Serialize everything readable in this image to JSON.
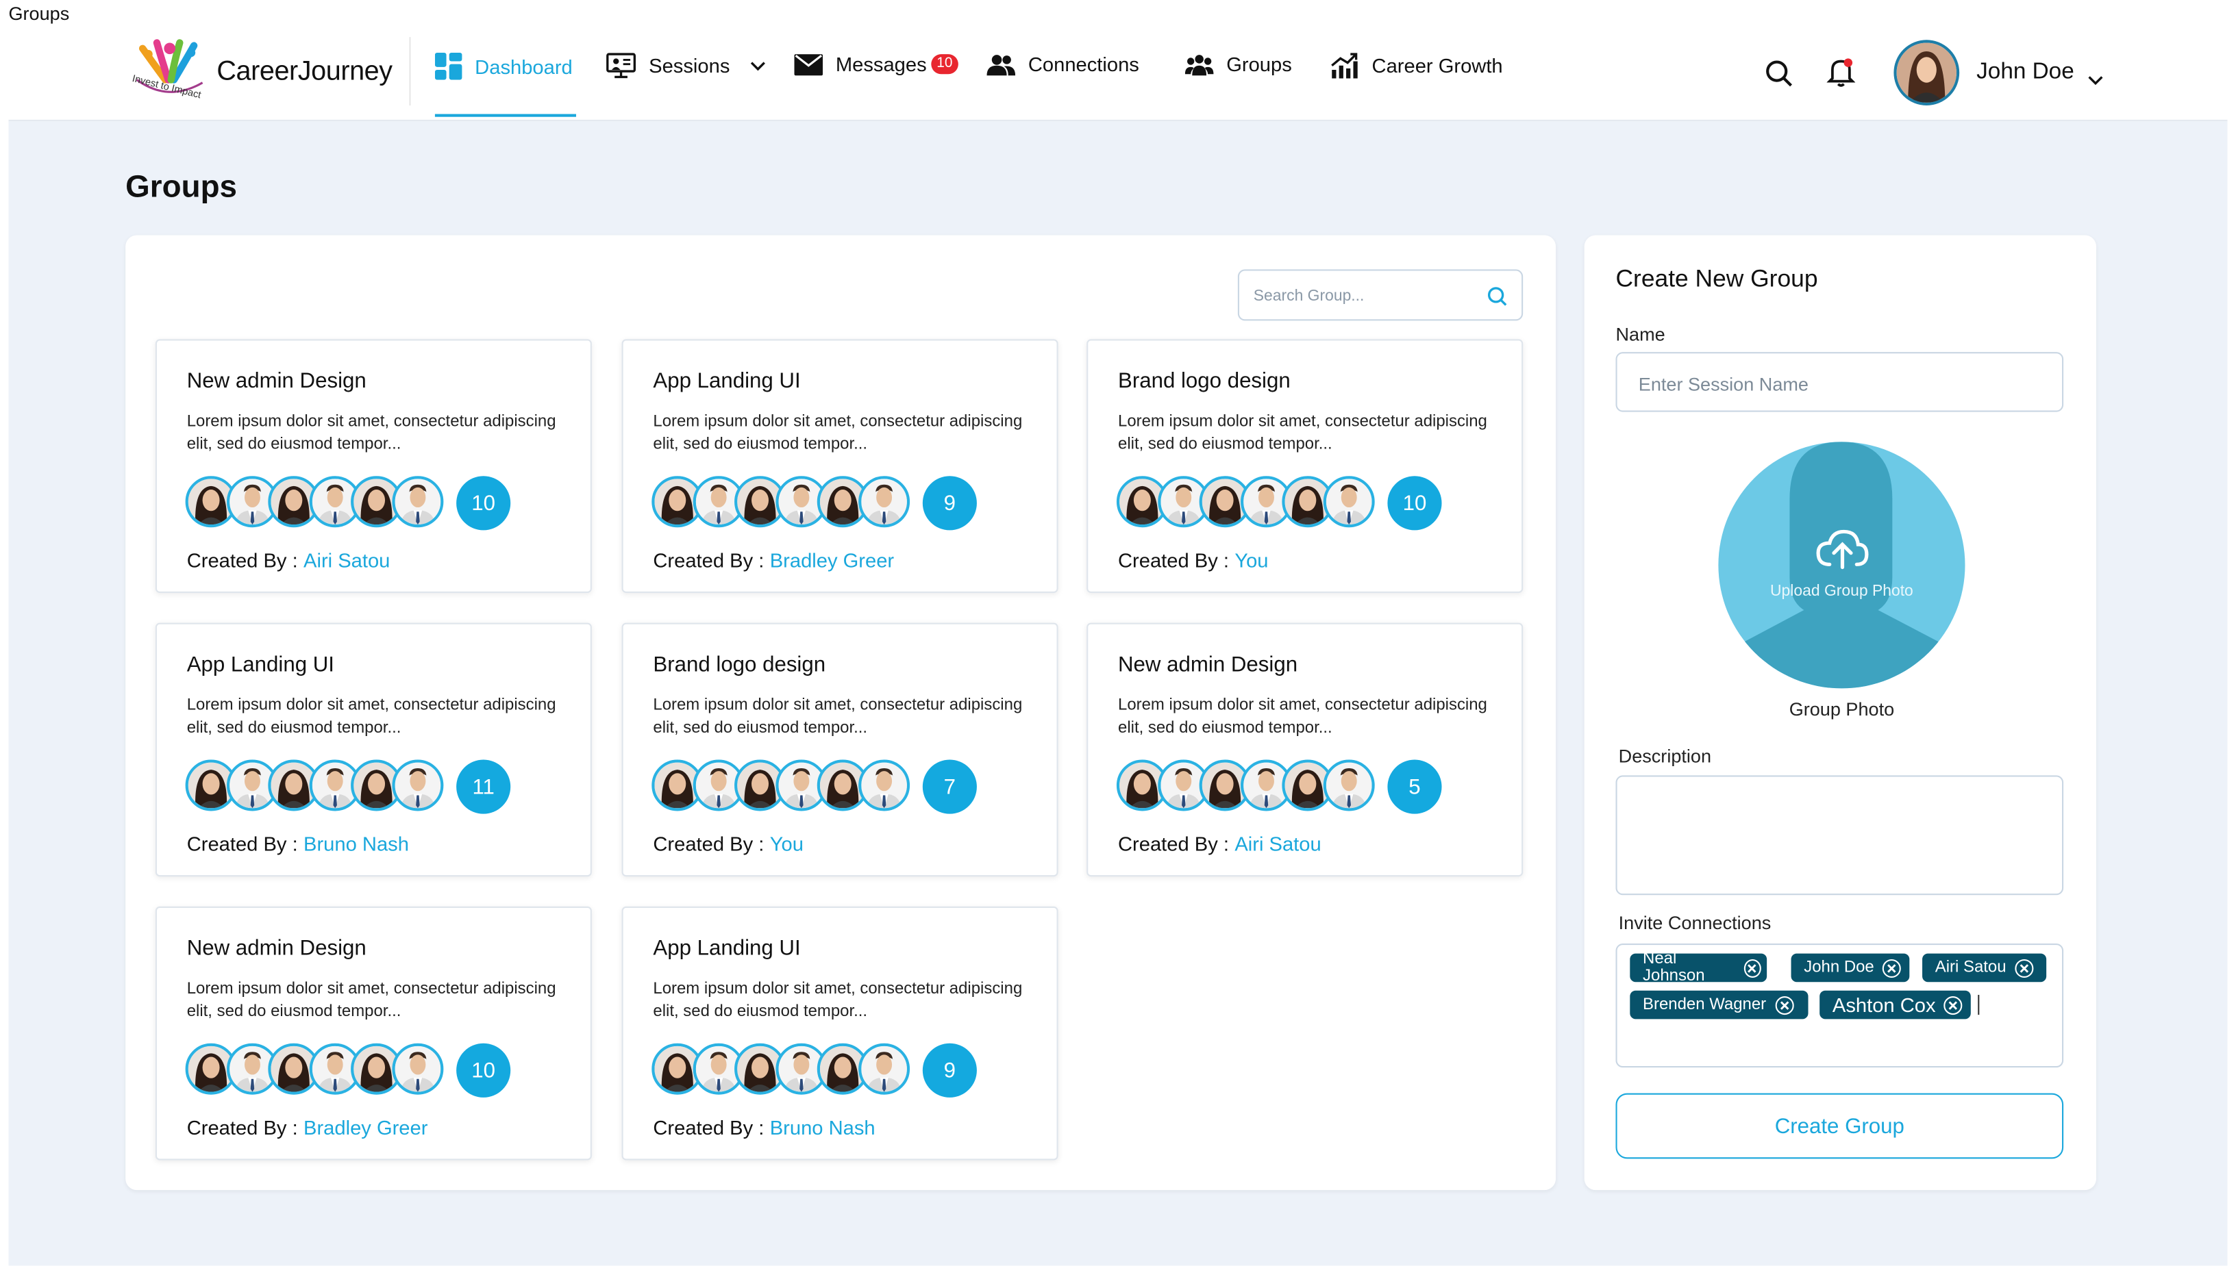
{
  "window_title": "Groups",
  "brand": {
    "name": "CareerJourney",
    "tagline": "Invest to Impact"
  },
  "nav": [
    {
      "label": "Dashboard",
      "icon": "dashboard-icon"
    },
    {
      "label": "Sessions",
      "icon": "sessions-icon"
    },
    {
      "label": "Messages",
      "icon": "messages-icon",
      "badge": "10"
    },
    {
      "label": "Connections",
      "icon": "connections-icon"
    },
    {
      "label": "Groups",
      "icon": "groups-icon"
    },
    {
      "label": "Career Growth",
      "icon": "career-growth-icon"
    }
  ],
  "user": {
    "name": "John Doe"
  },
  "page_title": "Groups",
  "search": {
    "placeholder": "Search Group..."
  },
  "created_by_label": "Created By :",
  "cards": [
    {
      "title": "New admin Design",
      "desc": "Lorem ipsum dolor sit amet, consectetur adipiscing elit, sed do eiusmod tempor...",
      "count": "10",
      "creator": "Airi Satou"
    },
    {
      "title": "App Landing UI",
      "desc": "Lorem ipsum dolor sit amet, consectetur adipiscing elit, sed do eiusmod tempor...",
      "count": "9",
      "creator": "Bradley Greer"
    },
    {
      "title": "Brand logo design",
      "desc": "Lorem ipsum dolor sit amet, consectetur adipiscing elit, sed do eiusmod tempor...",
      "count": "10",
      "creator": "You"
    },
    {
      "title": "App Landing UI",
      "desc": "Lorem ipsum dolor sit amet, consectetur adipiscing elit, sed do eiusmod tempor...",
      "count": "11",
      "creator": "Bruno Nash"
    },
    {
      "title": "Brand logo design",
      "desc": "Lorem ipsum dolor sit amet, consectetur adipiscing elit, sed do eiusmod tempor...",
      "count": "7",
      "creator": "You"
    },
    {
      "title": "New admin Design",
      "desc": "Lorem ipsum dolor sit amet, consectetur adipiscing elit, sed do eiusmod tempor...",
      "count": "5",
      "creator": "Airi Satou"
    },
    {
      "title": "New admin Design",
      "desc": "Lorem ipsum dolor sit amet, consectetur adipiscing elit, sed do eiusmod tempor...",
      "count": "10",
      "creator": "Bradley Greer"
    },
    {
      "title": "App Landing UI",
      "desc": "Lorem ipsum dolor sit amet, consectetur adipiscing elit, sed do eiusmod tempor...",
      "count": "9",
      "creator": "Bruno Nash"
    }
  ],
  "create_group": {
    "title": "Create New Group",
    "name_label": "Name",
    "name_placeholder": "Enter Session Name",
    "upload_label": "Upload Group Photo",
    "photo_label": "Group Photo",
    "description_label": "Description",
    "invite_label": "Invite Connections",
    "invited": [
      "Neal Johnson",
      "John Doe",
      "Airi Satou",
      "Brenden Wagner",
      "Ashton Cox"
    ],
    "button_label": "Create Group"
  },
  "colors": {
    "accent": "#1aa7dc",
    "chip": "#08526a",
    "badge": "#e8262f",
    "background": "#edf2f9"
  }
}
